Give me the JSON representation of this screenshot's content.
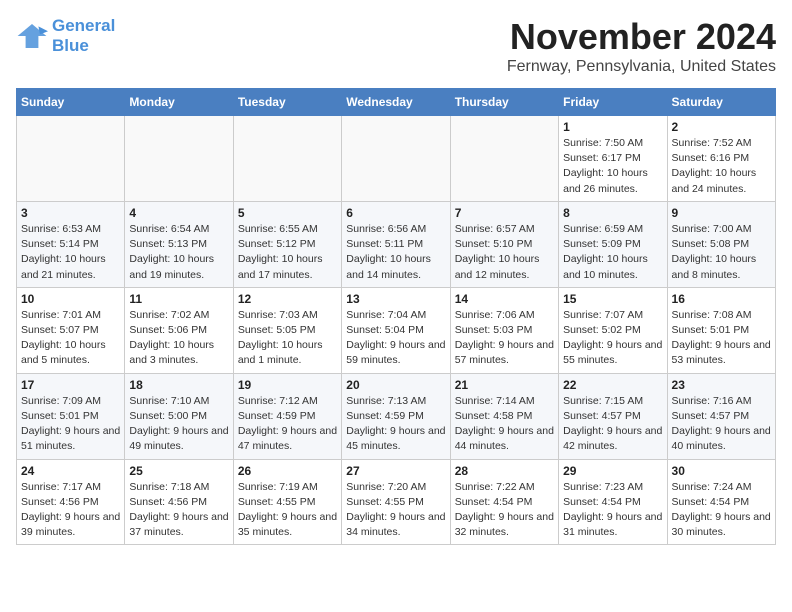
{
  "logo": {
    "line1": "General",
    "line2": "Blue"
  },
  "title": "November 2024",
  "location": "Fernway, Pennsylvania, United States",
  "days_of_week": [
    "Sunday",
    "Monday",
    "Tuesday",
    "Wednesday",
    "Thursday",
    "Friday",
    "Saturday"
  ],
  "weeks": [
    [
      {
        "day": "",
        "info": ""
      },
      {
        "day": "",
        "info": ""
      },
      {
        "day": "",
        "info": ""
      },
      {
        "day": "",
        "info": ""
      },
      {
        "day": "",
        "info": ""
      },
      {
        "day": "1",
        "info": "Sunrise: 7:50 AM\nSunset: 6:17 PM\nDaylight: 10 hours and 26 minutes."
      },
      {
        "day": "2",
        "info": "Sunrise: 7:52 AM\nSunset: 6:16 PM\nDaylight: 10 hours and 24 minutes."
      }
    ],
    [
      {
        "day": "3",
        "info": "Sunrise: 6:53 AM\nSunset: 5:14 PM\nDaylight: 10 hours and 21 minutes."
      },
      {
        "day": "4",
        "info": "Sunrise: 6:54 AM\nSunset: 5:13 PM\nDaylight: 10 hours and 19 minutes."
      },
      {
        "day": "5",
        "info": "Sunrise: 6:55 AM\nSunset: 5:12 PM\nDaylight: 10 hours and 17 minutes."
      },
      {
        "day": "6",
        "info": "Sunrise: 6:56 AM\nSunset: 5:11 PM\nDaylight: 10 hours and 14 minutes."
      },
      {
        "day": "7",
        "info": "Sunrise: 6:57 AM\nSunset: 5:10 PM\nDaylight: 10 hours and 12 minutes."
      },
      {
        "day": "8",
        "info": "Sunrise: 6:59 AM\nSunset: 5:09 PM\nDaylight: 10 hours and 10 minutes."
      },
      {
        "day": "9",
        "info": "Sunrise: 7:00 AM\nSunset: 5:08 PM\nDaylight: 10 hours and 8 minutes."
      }
    ],
    [
      {
        "day": "10",
        "info": "Sunrise: 7:01 AM\nSunset: 5:07 PM\nDaylight: 10 hours and 5 minutes."
      },
      {
        "day": "11",
        "info": "Sunrise: 7:02 AM\nSunset: 5:06 PM\nDaylight: 10 hours and 3 minutes."
      },
      {
        "day": "12",
        "info": "Sunrise: 7:03 AM\nSunset: 5:05 PM\nDaylight: 10 hours and 1 minute."
      },
      {
        "day": "13",
        "info": "Sunrise: 7:04 AM\nSunset: 5:04 PM\nDaylight: 9 hours and 59 minutes."
      },
      {
        "day": "14",
        "info": "Sunrise: 7:06 AM\nSunset: 5:03 PM\nDaylight: 9 hours and 57 minutes."
      },
      {
        "day": "15",
        "info": "Sunrise: 7:07 AM\nSunset: 5:02 PM\nDaylight: 9 hours and 55 minutes."
      },
      {
        "day": "16",
        "info": "Sunrise: 7:08 AM\nSunset: 5:01 PM\nDaylight: 9 hours and 53 minutes."
      }
    ],
    [
      {
        "day": "17",
        "info": "Sunrise: 7:09 AM\nSunset: 5:01 PM\nDaylight: 9 hours and 51 minutes."
      },
      {
        "day": "18",
        "info": "Sunrise: 7:10 AM\nSunset: 5:00 PM\nDaylight: 9 hours and 49 minutes."
      },
      {
        "day": "19",
        "info": "Sunrise: 7:12 AM\nSunset: 4:59 PM\nDaylight: 9 hours and 47 minutes."
      },
      {
        "day": "20",
        "info": "Sunrise: 7:13 AM\nSunset: 4:59 PM\nDaylight: 9 hours and 45 minutes."
      },
      {
        "day": "21",
        "info": "Sunrise: 7:14 AM\nSunset: 4:58 PM\nDaylight: 9 hours and 44 minutes."
      },
      {
        "day": "22",
        "info": "Sunrise: 7:15 AM\nSunset: 4:57 PM\nDaylight: 9 hours and 42 minutes."
      },
      {
        "day": "23",
        "info": "Sunrise: 7:16 AM\nSunset: 4:57 PM\nDaylight: 9 hours and 40 minutes."
      }
    ],
    [
      {
        "day": "24",
        "info": "Sunrise: 7:17 AM\nSunset: 4:56 PM\nDaylight: 9 hours and 39 minutes."
      },
      {
        "day": "25",
        "info": "Sunrise: 7:18 AM\nSunset: 4:56 PM\nDaylight: 9 hours and 37 minutes."
      },
      {
        "day": "26",
        "info": "Sunrise: 7:19 AM\nSunset: 4:55 PM\nDaylight: 9 hours and 35 minutes."
      },
      {
        "day": "27",
        "info": "Sunrise: 7:20 AM\nSunset: 4:55 PM\nDaylight: 9 hours and 34 minutes."
      },
      {
        "day": "28",
        "info": "Sunrise: 7:22 AM\nSunset: 4:54 PM\nDaylight: 9 hours and 32 minutes."
      },
      {
        "day": "29",
        "info": "Sunrise: 7:23 AM\nSunset: 4:54 PM\nDaylight: 9 hours and 31 minutes."
      },
      {
        "day": "30",
        "info": "Sunrise: 7:24 AM\nSunset: 4:54 PM\nDaylight: 9 hours and 30 minutes."
      }
    ]
  ]
}
